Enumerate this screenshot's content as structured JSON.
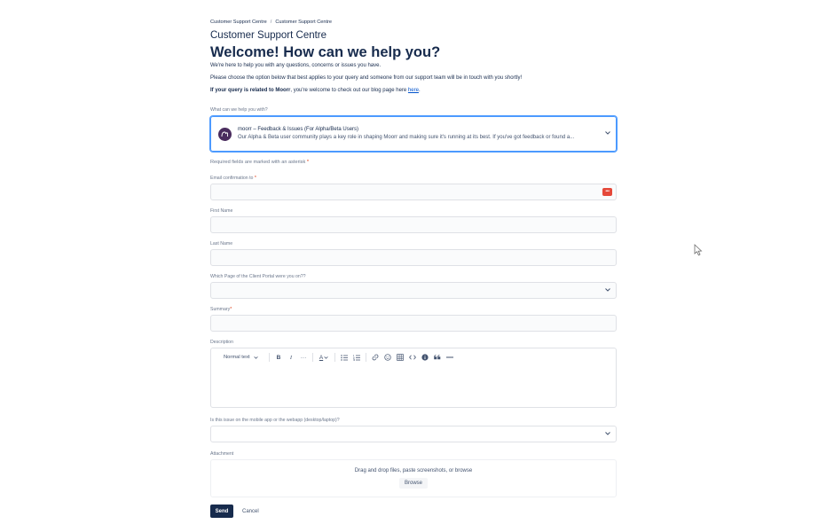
{
  "breadcrumb": [
    "Customer Support Centre",
    "Customer Support Centre"
  ],
  "breadcrumb_separator": "/",
  "portal_title": "Customer Support Centre",
  "welcome_heading": "Welcome! How can we help you?",
  "intro": {
    "line1": "We're here to help you with any questions, concerns or issues you have.",
    "line2": "Please choose the option below that best applies to your query and someone from our support team will be in touch with you shortly!",
    "line3_bold": "If your query is related to Moorr",
    "line3_rest": ", you're welcome to check out our blog page here ",
    "line3_link": "here",
    "line3_end": "."
  },
  "request_type": {
    "label": "What can we help you with?",
    "title": "moorr – Feedback & Issues (For Alpha/Beta Users)",
    "description": "Our Alpha & Beta user community plays a key role in shaping Moorr and making sure it's running at its best. If you've got feedback or found a..."
  },
  "required_note": "Required fields are marked with an asterisk",
  "required_star": "*",
  "fields": {
    "email": {
      "label": "Email confirmation to",
      "value": ""
    },
    "first_name": {
      "label": "First Name",
      "value": ""
    },
    "last_name": {
      "label": "Last Name",
      "value": ""
    },
    "page": {
      "label": "Which Page of the Client Portal were you on??",
      "value": ""
    },
    "summary": {
      "label": "Summary",
      "value": ""
    },
    "description": {
      "label": "Description"
    },
    "platform": {
      "label": "Is this issue on the mobile app or the webapp (desktop/laptop)?",
      "value": ""
    },
    "attachment": {
      "label": "Attachment",
      "drop_text": "Drag and drop files, paste screenshots, or browse",
      "browse_label": "Browse"
    }
  },
  "editor_toolbar": {
    "text_style": "Normal text",
    "bold": "B",
    "italic": "I",
    "more": "···",
    "text_color": "A"
  },
  "actions": {
    "send": "Send",
    "cancel": "Cancel"
  },
  "colors": {
    "accent": "#0052cc",
    "focus": "#4c9aff",
    "primary_button": "#172b4d",
    "avatar": "#4a2c5e"
  },
  "icons": {
    "password_manager": "password-manager-icon",
    "chevron": "chevron-down-icon",
    "link": "link-icon",
    "emoji": "emoji-icon",
    "table": "table-icon",
    "code": "code-icon",
    "info": "info-icon",
    "quote": "quote-icon",
    "divider": "divider-icon"
  }
}
